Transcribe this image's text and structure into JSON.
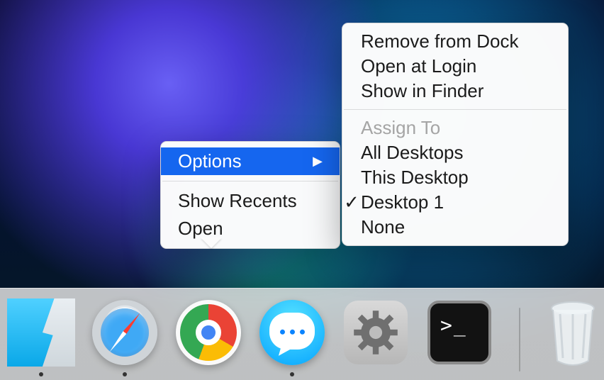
{
  "dock": {
    "items": [
      {
        "name": "finder",
        "running": true
      },
      {
        "name": "safari",
        "running": true
      },
      {
        "name": "chrome",
        "running": false
      },
      {
        "name": "messages",
        "running": true
      },
      {
        "name": "settings",
        "running": false
      },
      {
        "name": "terminal",
        "running": false
      }
    ],
    "trash": {
      "name": "trash"
    }
  },
  "context_menu": {
    "options_label": "Options",
    "show_recents_label": "Show Recents",
    "open_label": "Open"
  },
  "options_submenu": {
    "remove_label": "Remove from Dock",
    "open_at_login_label": "Open at Login",
    "show_in_finder_label": "Show in Finder",
    "assign_to_label": "Assign To",
    "all_desktops_label": "All Desktops",
    "this_desktop_label": "This Desktop",
    "desktop1_label": "Desktop 1",
    "none_label": "None",
    "checked": "Desktop 1"
  }
}
